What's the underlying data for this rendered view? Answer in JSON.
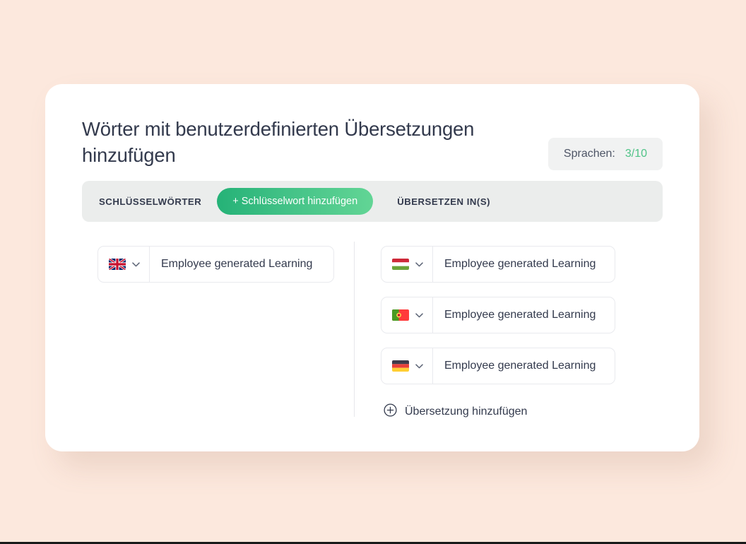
{
  "page": {
    "background_color": "#fce8dd"
  },
  "card": {
    "title": "Wörter mit benutzerdefinierten Übersetzungen hinzufügen",
    "languages_badge": {
      "label": "Sprachen:",
      "count": "3/10",
      "count_color": "#4fc387"
    },
    "tabs": {
      "keywords_label": "SCHLÜSSELWÖRTER",
      "add_keyword_label": "+ Schlüsselwort hinzufügen",
      "translate_into_label": "ÜBERSETZEN IN(S)",
      "add_keyword_gradient_from": "#25b277",
      "add_keyword_gradient_to": "#62d595"
    },
    "source_column": {
      "rows": [
        {
          "flag": "uk-flag-icon",
          "chevron": "chevron-down-icon",
          "value": "Employee generated Learning"
        }
      ]
    },
    "target_column": {
      "rows": [
        {
          "flag": "hungary-flag-icon",
          "chevron": "chevron-down-icon",
          "value": "Employee generated Learning"
        },
        {
          "flag": "portugal-flag-icon",
          "chevron": "chevron-down-icon",
          "value": "Employee generated Learning"
        },
        {
          "flag": "germany-flag-icon",
          "chevron": "chevron-down-icon",
          "value": "Employee generated Learning"
        }
      ],
      "add_translation_label": "Übersetzung hinzufügen",
      "add_translation_icon": "plus-circle-icon"
    }
  }
}
